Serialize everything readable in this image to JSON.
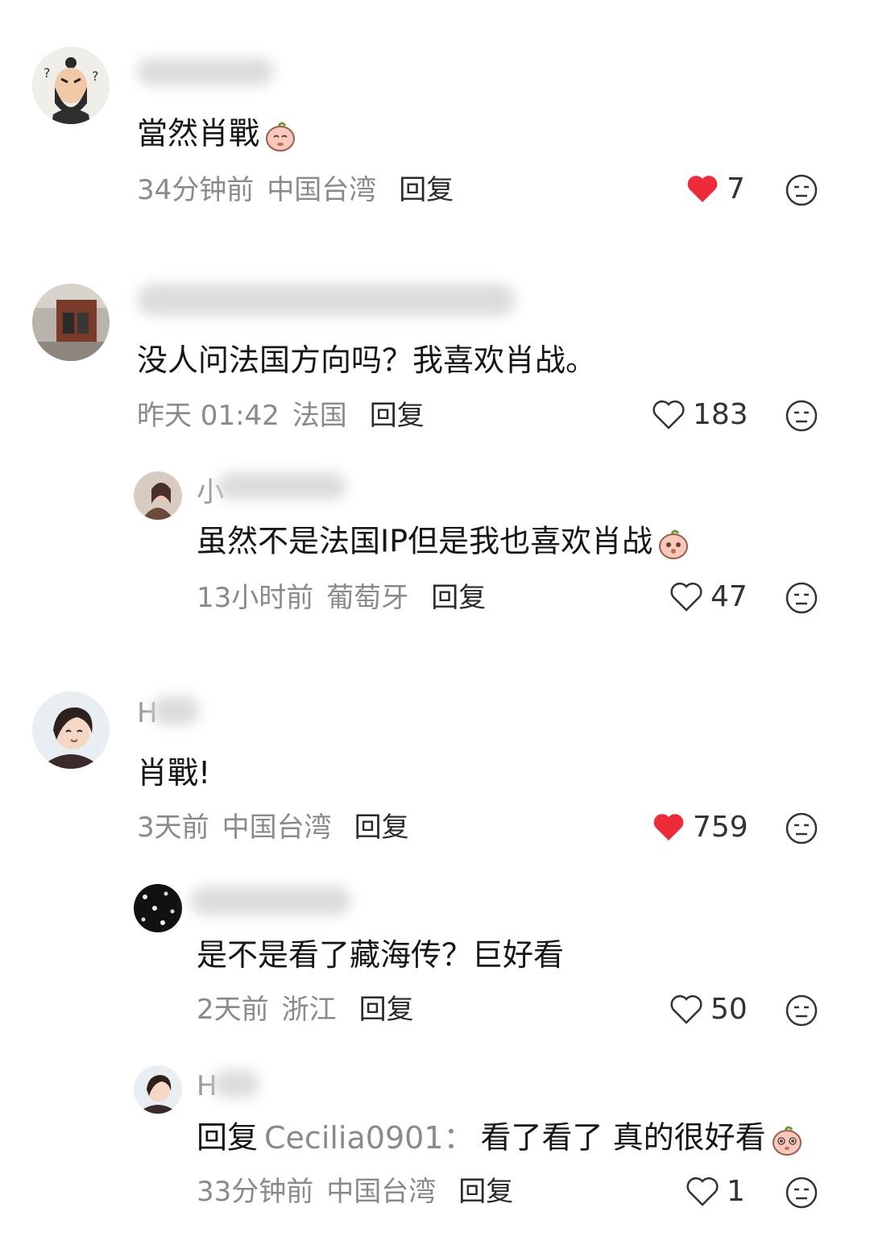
{
  "comments": [
    {
      "text": "當然肖戰",
      "time": "34分钟前",
      "location": "中国台湾",
      "reply_label": "回复",
      "likes": "7",
      "liked": true,
      "emoji": "peach-emoji"
    },
    {
      "text": "没人问法国方向吗？我喜欢肖战。",
      "time": "昨天 01:42",
      "location": "法国",
      "reply_label": "回复",
      "likes": "183",
      "liked": false,
      "replies": [
        {
          "name_initial": "小",
          "text": "虽然不是法国IP但是我也喜欢肖战",
          "time": "13小时前",
          "location": "葡萄牙",
          "reply_label": "回复",
          "likes": "47",
          "emoji": "peach-emoji"
        }
      ]
    },
    {
      "name_initial": "H",
      "text": "肖戰!",
      "time": "3天前",
      "location": "中国台湾",
      "reply_label": "回复",
      "likes": "759",
      "liked": true,
      "replies": [
        {
          "text": "是不是看了藏海传？巨好看",
          "time": "2天前",
          "location": "浙江",
          "reply_label": "回复",
          "likes": "50"
        },
        {
          "name_initial": "H",
          "reply_prefix": "回复",
          "mention": "Cecilia0901：",
          "text": "看了看了 真的很好看",
          "time": "33分钟前",
          "location": "中国台湾",
          "reply_label": "回复",
          "likes": "1",
          "emoji": "peach-emoji"
        }
      ]
    }
  ],
  "colors": {
    "heart_red": "#ee2b3b",
    "meta_gray": "#8a8a8a"
  },
  "icons": {
    "like": "heart-icon",
    "dislike": "meh-face-icon"
  }
}
